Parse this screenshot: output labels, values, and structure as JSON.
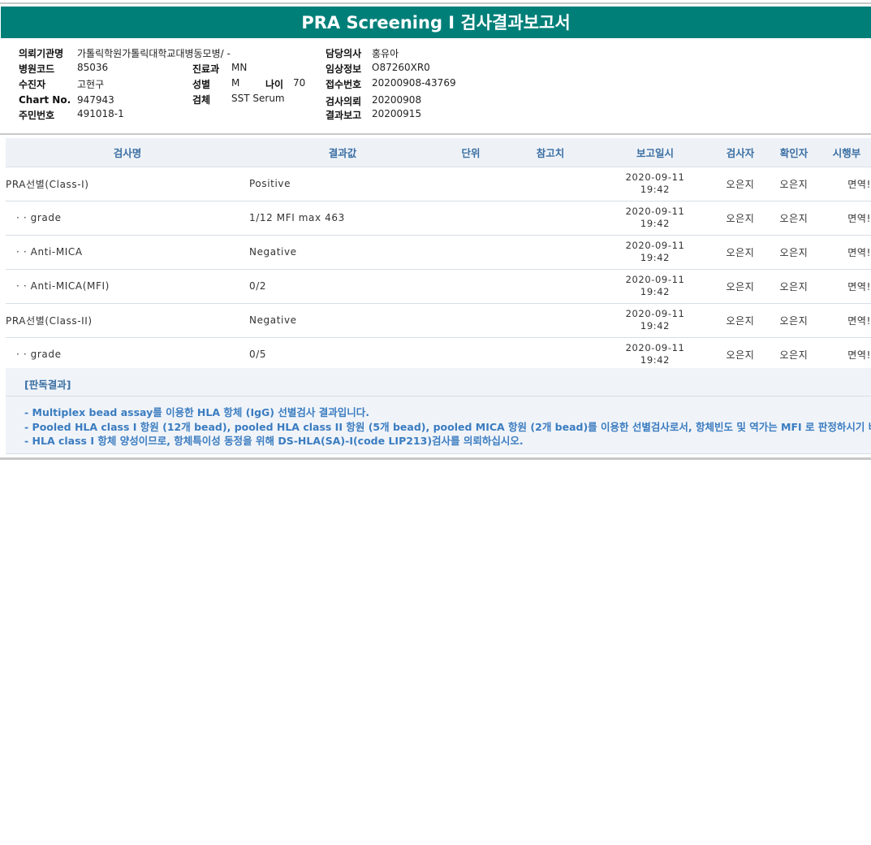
{
  "report": {
    "title": "PRA Screening Ⅰ 검사결과보고서"
  },
  "info": {
    "institution_label": "의뢰기관명",
    "institution_value": "가톨릭학원가톨릭대학교대병동모병/ -",
    "hospital_code_label": "병원코드",
    "hospital_code_value": "85036",
    "patient_label": "수진자",
    "patient_value": "고현구",
    "chart_no_label": "Chart No.",
    "chart_no_value": "947943",
    "resident_no_label": "주민번호",
    "resident_no_value": "491018-1",
    "department_label": "진료과",
    "department_value": "MN",
    "sex_label": "성별",
    "sex_value": "M",
    "age_label": "나이",
    "age_value": "70",
    "specimen_label": "검체",
    "specimen_value": "SST Serum",
    "doctor_label": "담당의사",
    "doctor_value": "홍유아",
    "clinical_label": "임상정보",
    "clinical_value": "O87260XR0",
    "receipt_label": "접수번호",
    "receipt_value": "20200908-43769",
    "request_label": "검사의뢰",
    "request_value": "20200908",
    "report_label": "결과보고",
    "report_value": "20200915"
  },
  "table": {
    "headers": {
      "name": "검사명",
      "result": "결과값",
      "unit": "단위",
      "reference": "참고치",
      "report_time": "보고일시",
      "tester": "검사자",
      "confirmer": "확인자",
      "department": "시행부"
    },
    "rows": [
      {
        "name": "PRA선별(Class-I)",
        "result": "Positive",
        "unit": "",
        "reference": "",
        "date": "2020-09-11",
        "time": "19:42",
        "tester": "오은지",
        "confirmer": "오은지",
        "department": "면역!"
      },
      {
        "name": "· · grade",
        "result": "1/12 MFI max 463",
        "unit": "",
        "reference": "",
        "date": "2020-09-11",
        "time": "19:42",
        "tester": "오은지",
        "confirmer": "오은지",
        "department": "면역!"
      },
      {
        "name": "· · Anti-MICA",
        "result": "Negative",
        "unit": "",
        "reference": "",
        "date": "2020-09-11",
        "time": "19:42",
        "tester": "오은지",
        "confirmer": "오은지",
        "department": "면역!"
      },
      {
        "name": "· · Anti-MICA(MFI)",
        "result": "0/2",
        "unit": "",
        "reference": "",
        "date": "2020-09-11",
        "time": "19:42",
        "tester": "오은지",
        "confirmer": "오은지",
        "department": "면역!"
      },
      {
        "name": "PRA선별(Class-II)",
        "result": "Negative",
        "unit": "",
        "reference": "",
        "date": "2020-09-11",
        "time": "19:42",
        "tester": "오은지",
        "confirmer": "오은지",
        "department": "면역!"
      },
      {
        "name": "· · grade",
        "result": "0/5",
        "unit": "",
        "reference": "",
        "date": "2020-09-11",
        "time": "19:42",
        "tester": "오은지",
        "confirmer": "오은지",
        "department": "면역!"
      }
    ]
  },
  "judgement": {
    "title": "[판독결과]",
    "notes": [
      "- Multiplex bead assay를 이용한 HLA 항체 (IgG) 선별검사 결과입니다.",
      "- Pooled HLA class I 항원 (12개 bead), pooled HLA class II 항원 (5개 bead), pooled MICA 항원 (2개 bead)를 이용한 선별검사로서, 항체빈도 및 역가는 MFI 로 판정하시기 바랍니다.",
      "- HLA class I 항체 양성이므로, 항체특이성 동정을 위해 DS-HLA(SA)-I(code LIP213)검사를 의뢰하십시오."
    ]
  },
  "colors": {
    "title_bar": "#007f79",
    "header_text": "#3b6fa3",
    "note_text": "#3b7cc0"
  }
}
